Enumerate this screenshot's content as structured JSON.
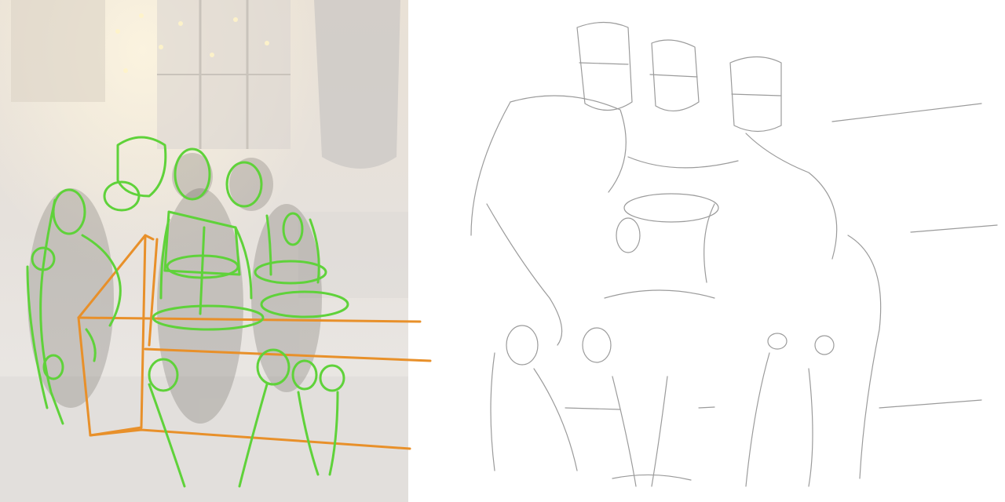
{
  "image": {
    "kind": "figure-drawing-comparison",
    "left_panel": "reference-photo-with-gesture-overlay",
    "right_panel": "pencil-sketch"
  },
  "colors": {
    "photo_wash": "#ece7e1",
    "figure_lines": "#5fd23a",
    "perspective_box": "#e8902a",
    "pencil": "#8a8a8a",
    "background": "#ffffff"
  },
  "icons": {
    "left": "reference-photo-icon",
    "right": "pencil-sketch-icon"
  }
}
